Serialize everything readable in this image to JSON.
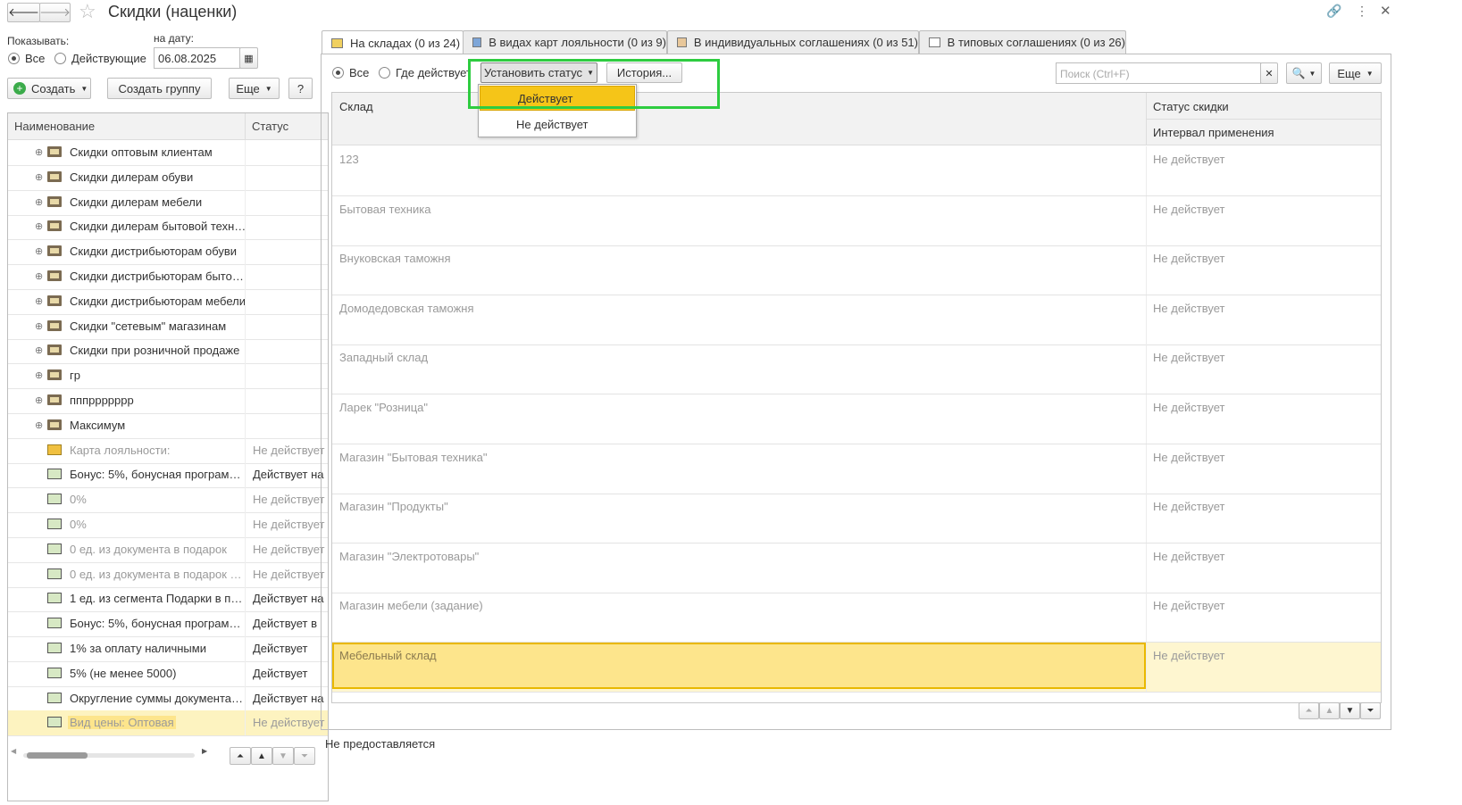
{
  "window": {
    "title": "Скидки (наценки)"
  },
  "left": {
    "show_label": "Показывать:",
    "radio_all": "Все",
    "radio_active": "Действующие",
    "date_label": "на дату:",
    "date_value": "06.08.2025",
    "create_btn": "Создать",
    "create_group_btn": "Создать группу",
    "more_btn": "Еще",
    "help_btn": "?",
    "col_name": "Наименование",
    "col_status": "Статус",
    "rows": [
      {
        "name": "Скидки оптовым клиентам",
        "status": "",
        "kind": "folder"
      },
      {
        "name": "Скидки дилерам обуви",
        "status": "",
        "kind": "folder"
      },
      {
        "name": "Скидки дилерам мебели",
        "status": "",
        "kind": "folder"
      },
      {
        "name": "Скидки дилерам бытовой техн…",
        "status": "",
        "kind": "folder"
      },
      {
        "name": "Скидки дистрибьюторам обуви",
        "status": "",
        "kind": "folder"
      },
      {
        "name": "Скидки дистрибьюторам быто…",
        "status": "",
        "kind": "folder"
      },
      {
        "name": "Скидки дистрибьюторам мебели",
        "status": "",
        "kind": "folder"
      },
      {
        "name": "Скидки \"сетевым\" магазинам",
        "status": "",
        "kind": "folder"
      },
      {
        "name": "Скидки при розничной продаже",
        "status": "",
        "kind": "folder"
      },
      {
        "name": "гр",
        "status": "",
        "kind": "folder"
      },
      {
        "name": "пппррррррр",
        "status": "",
        "kind": "folder"
      },
      {
        "name": "Максимум",
        "status": "",
        "kind": "folder"
      },
      {
        "name": "Карта лояльности:",
        "status": "Не действует",
        "kind": "mail"
      },
      {
        "name": "Бонус: 5%, бонусная програм…",
        "status": "Действует на",
        "kind": "doc"
      },
      {
        "name": "0%",
        "status": "Не действует",
        "kind": "doc"
      },
      {
        "name": "0%",
        "status": "Не действует",
        "kind": "doc"
      },
      {
        "name": "0 ед. из документа в подарок",
        "status": "Не действует",
        "kind": "doc"
      },
      {
        "name": "0 ед. из документа в подарок …",
        "status": "Не действует",
        "kind": "doc"
      },
      {
        "name": "1 ед. из сегмента Подарки в п…",
        "status": "Действует на",
        "kind": "doc"
      },
      {
        "name": "Бонус: 5%, бонусная програм…",
        "status": "Действует в",
        "kind": "doc"
      },
      {
        "name": "1% за оплату наличными",
        "status": "Действует",
        "kind": "doc"
      },
      {
        "name": "5% (не менее 5000)",
        "status": "Действует",
        "kind": "doc"
      },
      {
        "name": "Округление суммы документа…",
        "status": "Действует на",
        "kind": "doc"
      },
      {
        "name": "Вид цены: Оптовая",
        "status": "Не действует",
        "kind": "doc"
      }
    ]
  },
  "tabs": [
    {
      "label": "На складах (0 из 24)"
    },
    {
      "label": "В видах карт лояльности (0 из 9)"
    },
    {
      "label": "В индивидуальных соглашениях (0 из 51)"
    },
    {
      "label": "В типовых соглашениях (0 из 26)"
    }
  ],
  "right": {
    "radio_all": "Все",
    "radio_where": "Где действует",
    "set_status_btn": "Установить статус",
    "history_btn": "История...",
    "search_placeholder": "Поиск (Ctrl+F)",
    "more_btn": "Еще",
    "col_warehouse": "Склад",
    "col_status": "Статус скидки",
    "col_interval": "Интервал применения",
    "dropdown": [
      "Действует",
      "Не действует"
    ],
    "rows": [
      {
        "name": "123",
        "status": "Не действует"
      },
      {
        "name": "Бытовая техника",
        "status": "Не действует"
      },
      {
        "name": "Внуковская таможня",
        "status": "Не действует"
      },
      {
        "name": "Домодедовская таможня",
        "status": "Не действует"
      },
      {
        "name": "Западный склад",
        "status": "Не действует"
      },
      {
        "name": "Ларек \"Розница\"",
        "status": "Не действует"
      },
      {
        "name": "Магазин \"Бытовая техника\"",
        "status": "Не действует"
      },
      {
        "name": "Магазин \"Продукты\"",
        "status": "Не действует"
      },
      {
        "name": "Магазин \"Электротовары\"",
        "status": "Не действует"
      },
      {
        "name": "Магазин мебели (задание)",
        "status": "Не действует"
      },
      {
        "name": "Мебельный склад",
        "status": "Не действует"
      }
    ],
    "footer_text": "Не предоставляется"
  },
  "colors": {
    "accent_green": "#4caf50",
    "highlight": "#fde58c",
    "menu_active": "#f5c518",
    "callout_box": "#2ecc40"
  }
}
